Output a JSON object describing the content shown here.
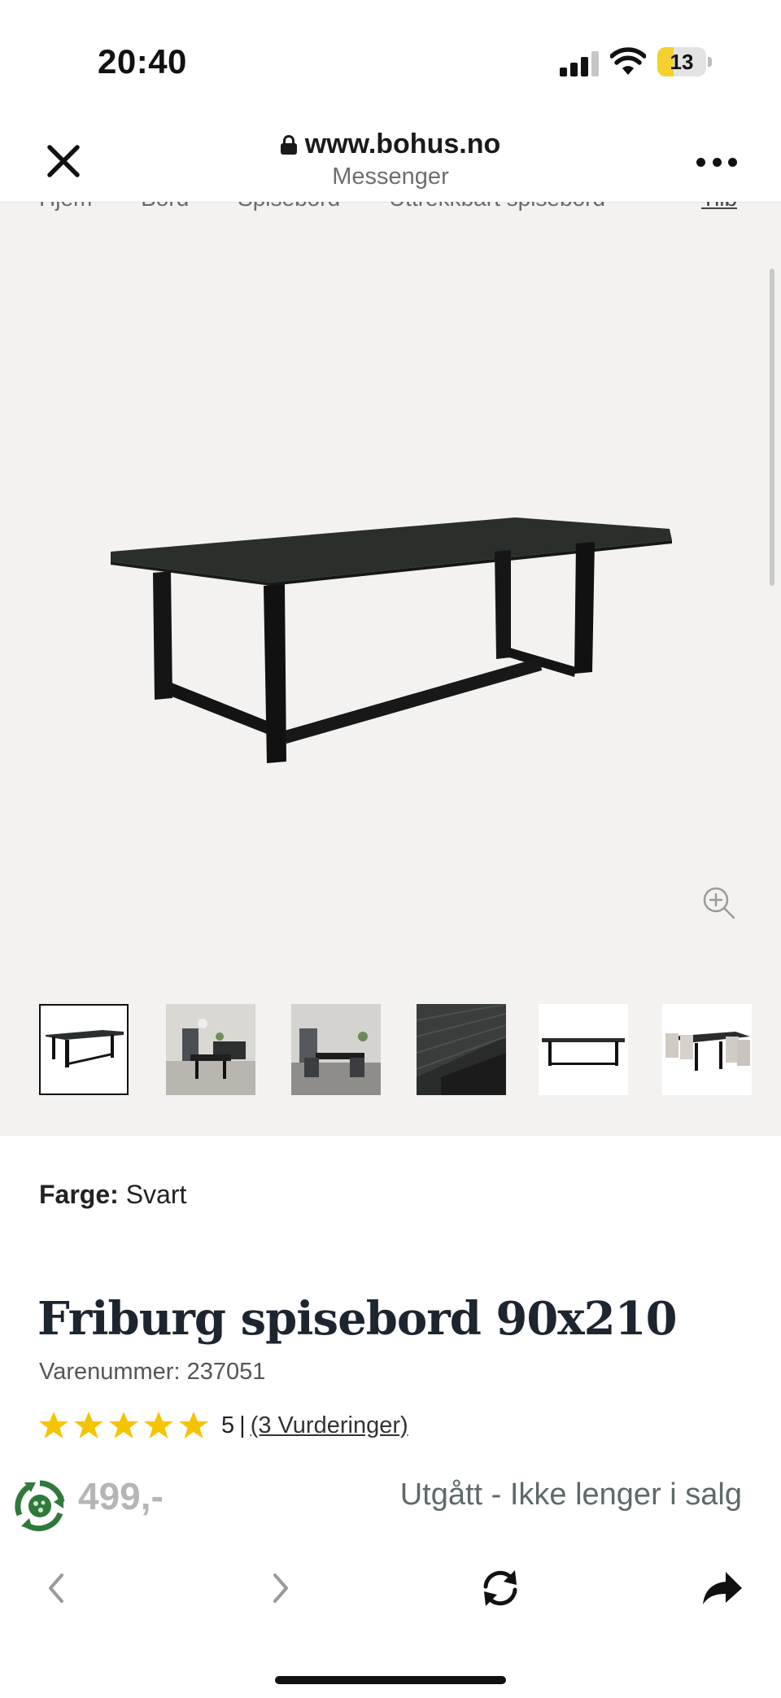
{
  "status_bar": {
    "time": "20:40",
    "battery_level": "13",
    "battery_fraction": 0.13,
    "icons": [
      "signal-icon",
      "wifi-icon",
      "battery-icon"
    ]
  },
  "browser": {
    "url": "www.bohus.no",
    "subtitle": "Messenger",
    "icons": [
      "close-icon",
      "lock-icon",
      "more-icon"
    ]
  },
  "breadcrumb": {
    "items": [
      "Hjem",
      "Bord",
      "Spisebord",
      "Uttrekkbart spisebord"
    ],
    "last": "Tilb"
  },
  "gallery": {
    "thumbnail_count": 6,
    "selected_index": 0,
    "zoom_icon": "zoom-in-icon"
  },
  "product": {
    "color_label": "Farge:",
    "color_value": "Svart",
    "title": "Friburg spisebord 90x210",
    "sku": "Varenummer: 237051",
    "rating_value": "5",
    "rating_stars": 5,
    "rating_separator": "|",
    "rating_link": "(3 Vurderinger)",
    "price": "499,-",
    "availability": "Utgått - Ikke lenger i salg"
  },
  "colors": {
    "star": "#f5c400",
    "gallery_bg": "#f4f2f0",
    "title": "#1c2530",
    "eco_green": "#2f7a3a"
  },
  "toolbar": {
    "icons": [
      "back-icon",
      "forward-icon",
      "reload-icon",
      "share-icon"
    ]
  }
}
